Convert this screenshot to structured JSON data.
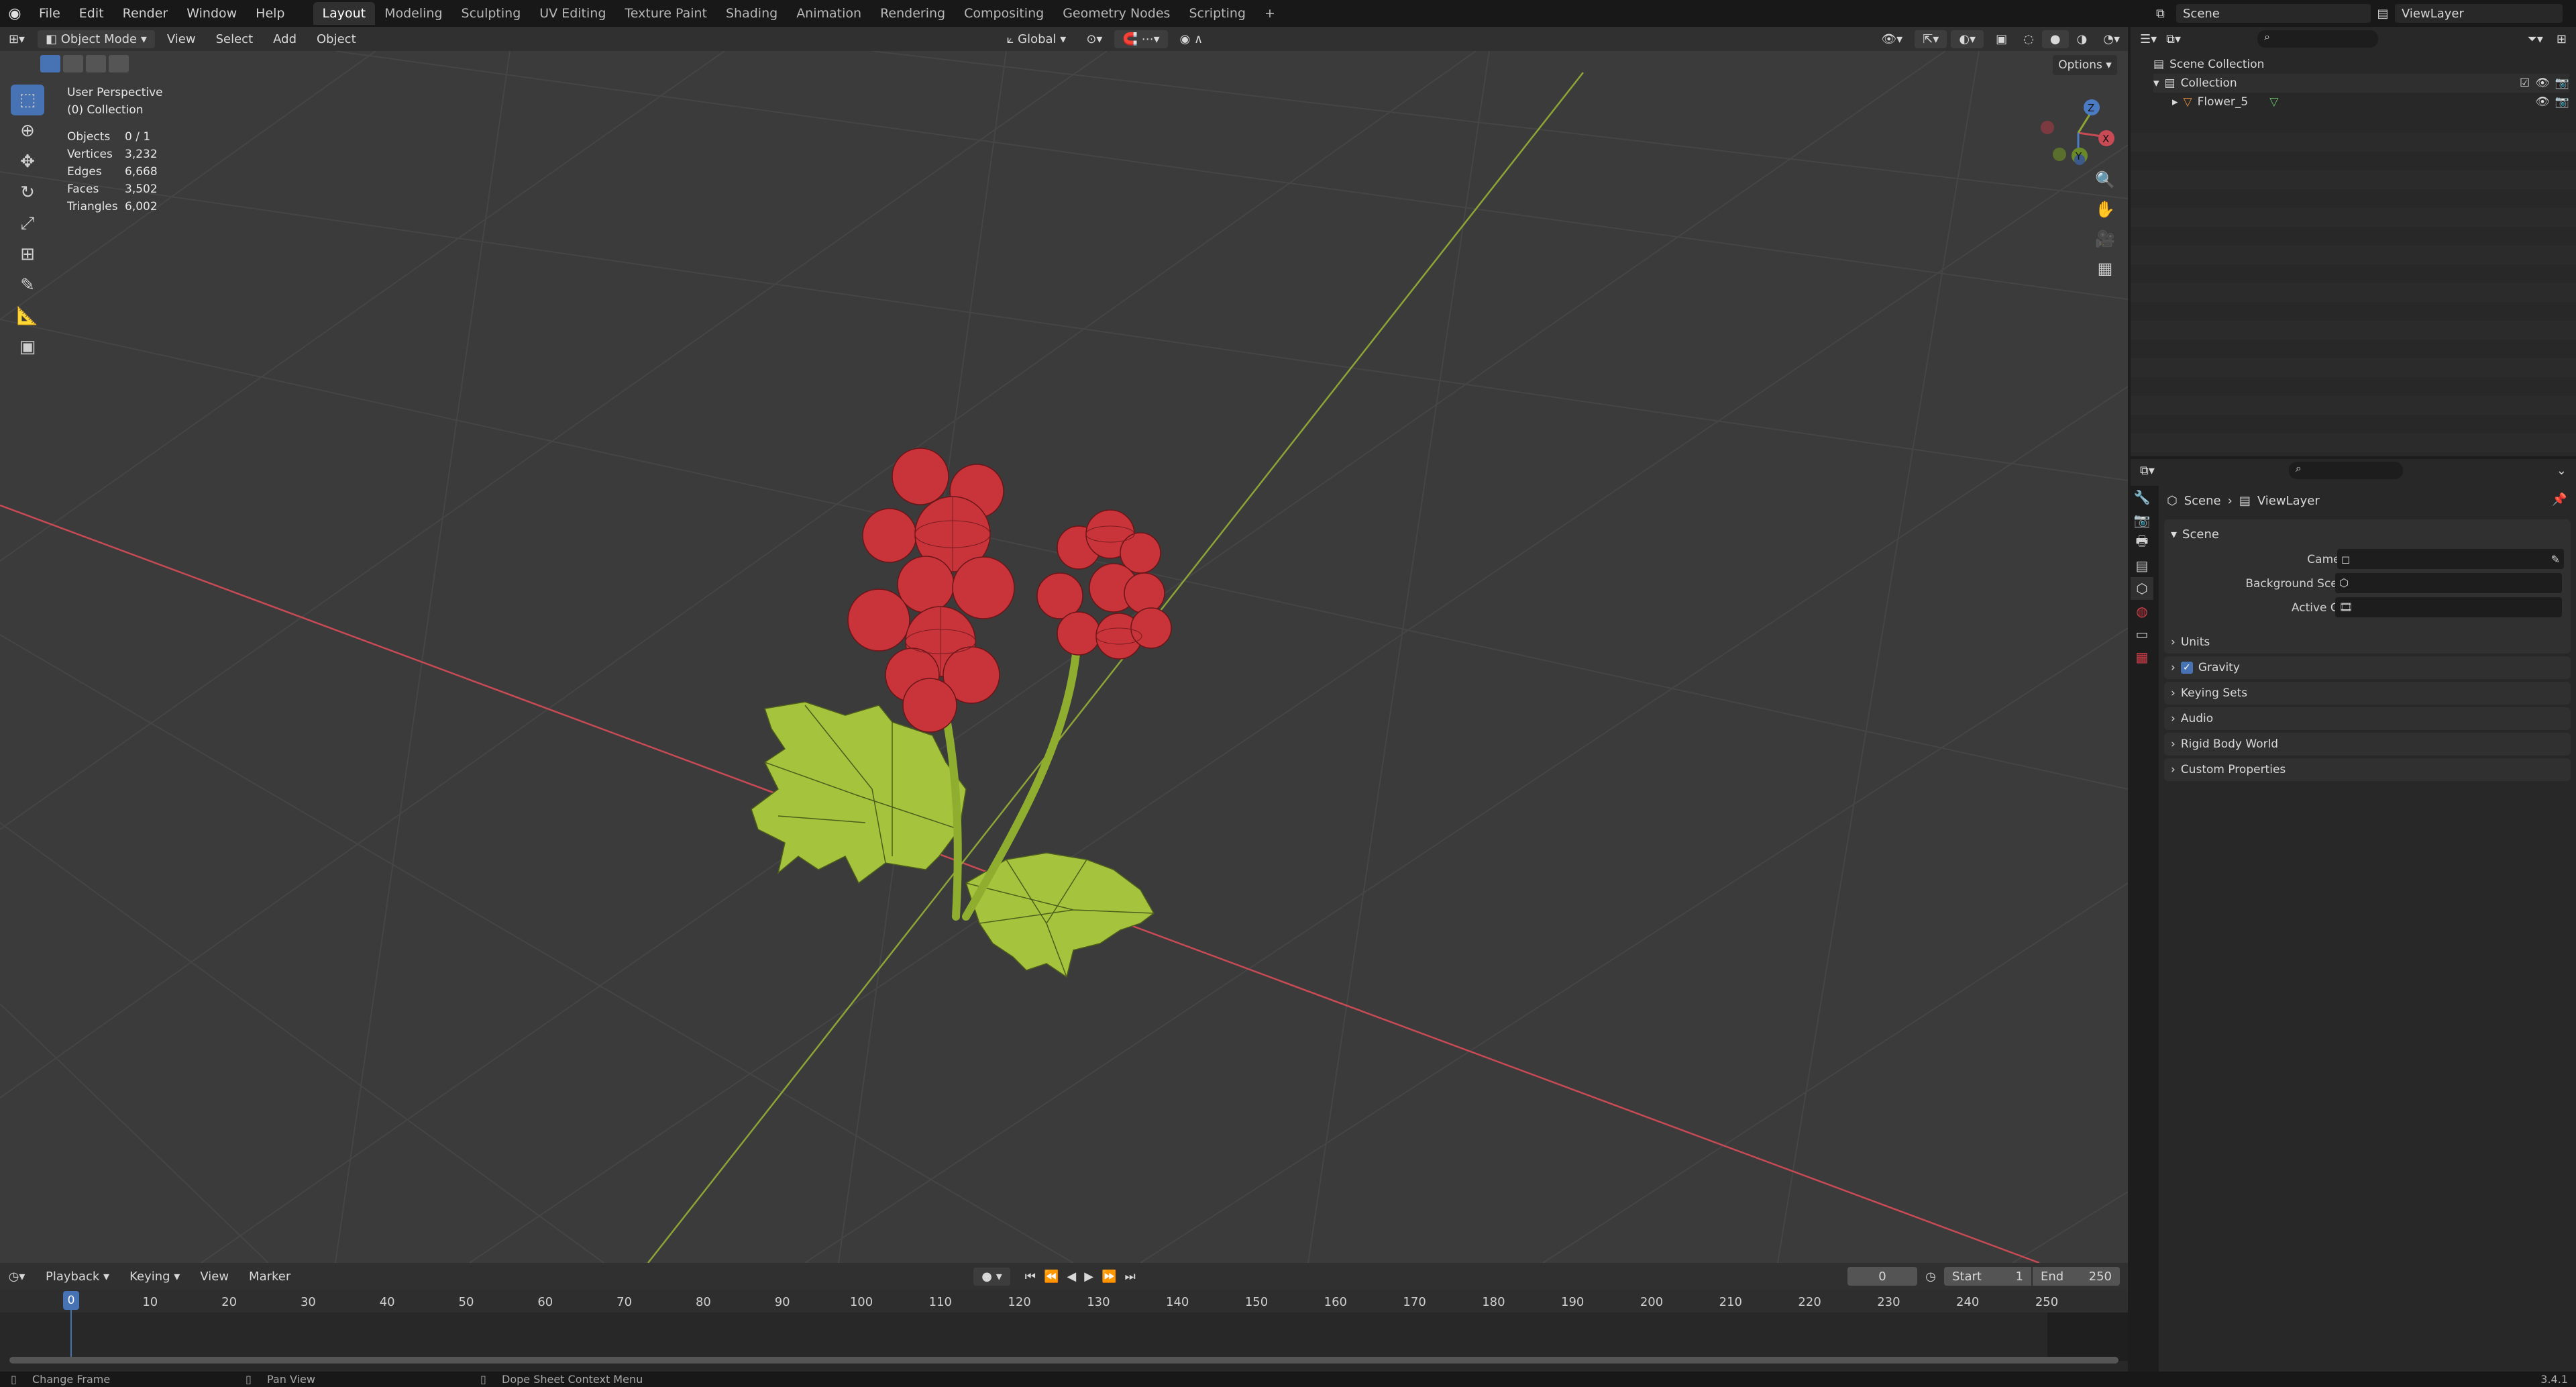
{
  "app": {
    "version": "3.4.1"
  },
  "menu": [
    "File",
    "Edit",
    "Render",
    "Window",
    "Help"
  ],
  "workspaces": [
    "Layout",
    "Modeling",
    "Sculpting",
    "UV Editing",
    "Texture Paint",
    "Shading",
    "Animation",
    "Rendering",
    "Compositing",
    "Geometry Nodes",
    "Scripting"
  ],
  "workspace_add": "+",
  "top_right": {
    "scene": "Scene",
    "view_layer": "ViewLayer"
  },
  "viewport_header": {
    "mode": "Object Mode",
    "menus": [
      "View",
      "Select",
      "Add",
      "Object"
    ],
    "orientation": "Global",
    "options": "Options"
  },
  "overlay": {
    "perspective": "User Perspective",
    "collection": "(0) Collection",
    "stats": [
      {
        "label": "Objects",
        "value": "0 / 1"
      },
      {
        "label": "Vertices",
        "value": "3,232"
      },
      {
        "label": "Edges",
        "value": "6,668"
      },
      {
        "label": "Faces",
        "value": "3,502"
      },
      {
        "label": "Triangles",
        "value": "6,002"
      }
    ]
  },
  "gizmo": {
    "x": "X",
    "y": "Y",
    "z": "Z"
  },
  "tools": [
    "select-box",
    "cursor",
    "move",
    "rotate",
    "scale",
    "transform",
    "annotate",
    "measure",
    "add-cube"
  ],
  "outliner": {
    "root": "Scene Collection",
    "collection": "Collection",
    "object": "Flower_5"
  },
  "properties": {
    "breadcrumb": [
      "Scene",
      "ViewLayer"
    ],
    "panel_title": "Scene",
    "fields": [
      "Camera",
      "Background Scene",
      "Active Clip"
    ],
    "sections": [
      "Units",
      "Gravity",
      "Keying Sets",
      "Audio",
      "Rigid Body World",
      "Custom Properties"
    ],
    "gravity_checked": true
  },
  "timeline": {
    "menus": [
      "Playback",
      "Keying",
      "View",
      "Marker"
    ],
    "current_frame": "0",
    "start_label": "Start",
    "start_value": "1",
    "end_label": "End",
    "end_value": "250",
    "ticks": [
      "0",
      "10",
      "20",
      "30",
      "40",
      "50",
      "60",
      "70",
      "80",
      "90",
      "100",
      "110",
      "120",
      "130",
      "140",
      "150",
      "160",
      "170",
      "180",
      "190",
      "200",
      "210",
      "220",
      "230",
      "240",
      "250"
    ]
  },
  "status": {
    "left": "Change Frame",
    "middle": "Pan View",
    "right": "Dope Sheet Context Menu"
  },
  "colors": {
    "accent": "#4772b3",
    "x_axis": "#c84a55",
    "y_axis": "#8da436",
    "berry": "#c8343a",
    "leaf": "#a6c33e"
  }
}
